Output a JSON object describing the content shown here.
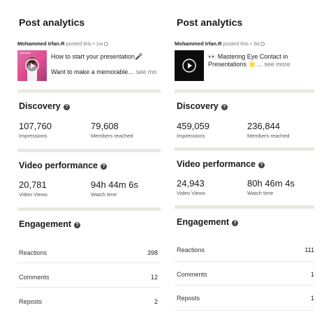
{
  "left": {
    "title": "Post analytics",
    "author": "Mohammed Irfan.R",
    "posted_meta": " posted this • 1w",
    "thumb_label": "Openness",
    "post_line1": "How to start your presentation🎤",
    "post_line2": "Want to make a memorable…",
    "see_more": " see mo",
    "discovery": {
      "title": "Discovery",
      "impressions_value": "107,760",
      "impressions_label": "Impressions",
      "members_value": "79,608",
      "members_label": "Members reached"
    },
    "video": {
      "title": "Video performance",
      "views_value": "20,781",
      "views_label": "Video Views",
      "watch_value": "94h 44m 6s",
      "watch_label": "Watch time"
    },
    "engagement": {
      "title": "Engagement",
      "rows": [
        {
          "label": "Reactions",
          "value": "398"
        },
        {
          "label": "Comments",
          "value": "12"
        },
        {
          "label": "Reposts",
          "value": "2"
        }
      ]
    }
  },
  "right": {
    "title": "Post analytics",
    "author": "Mohammed Irfan.R",
    "posted_meta": " posted this • 3d",
    "post_line1": "👀 Mastering Eye Contact in",
    "post_line2": "Presentations 🌟…",
    "see_more": " see more",
    "discovery": {
      "title": "Discovery",
      "impressions_value": "459,059",
      "impressions_label": "Impressions",
      "members_value": "236,844",
      "members_label": "Members reached"
    },
    "video": {
      "title": "Video performance",
      "views_value": "24,943",
      "views_label": "Video Views",
      "watch_value": "80h 46m 4s",
      "watch_label": "Watch time"
    },
    "engagement": {
      "title": "Engagement",
      "rows": [
        {
          "label": "Reactions",
          "value": "111"
        },
        {
          "label": "Comments",
          "value": "1"
        },
        {
          "label": "Reposts",
          "value": "1"
        }
      ]
    }
  }
}
